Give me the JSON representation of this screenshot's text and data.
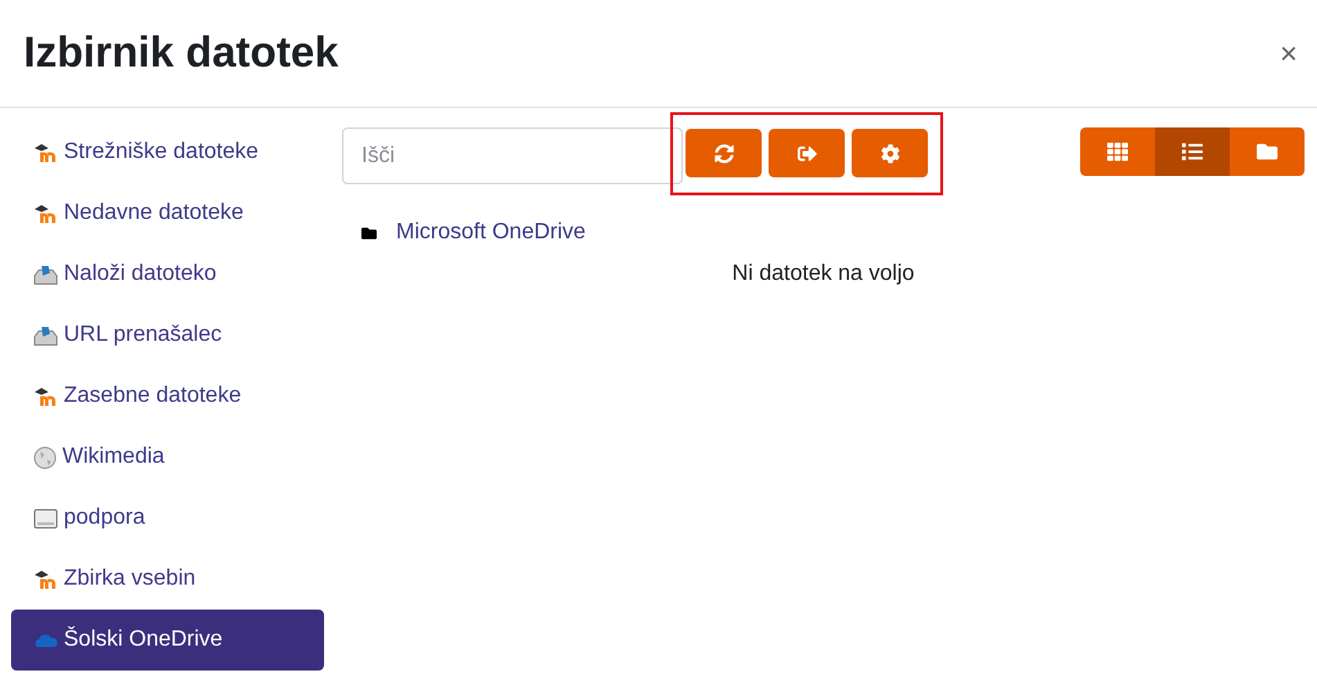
{
  "dialog": {
    "title": "Izbirnik datotek",
    "close": "×"
  },
  "sidebar": {
    "items": [
      {
        "label": "Strežniške datoteke",
        "kind": "moodle",
        "selected": false
      },
      {
        "label": "Nedavne datoteke",
        "kind": "moodle",
        "selected": false
      },
      {
        "label": "Naloži datoteko",
        "kind": "upload",
        "selected": false
      },
      {
        "label": "URL prenašalec",
        "kind": "upload",
        "selected": false
      },
      {
        "label": "Zasebne datoteke",
        "kind": "moodle",
        "selected": false
      },
      {
        "label": "Wikimedia",
        "kind": "wiki",
        "selected": false
      },
      {
        "label": "podpora",
        "kind": "server",
        "selected": false
      },
      {
        "label": "Zbirka vsebin",
        "kind": "moodle",
        "selected": false
      },
      {
        "label": "Šolski OneDrive",
        "kind": "onedrive",
        "selected": true
      }
    ]
  },
  "search": {
    "placeholder": "Išči"
  },
  "toolbar": {
    "highlighted": true,
    "buttons": [
      {
        "kind": "refresh"
      },
      {
        "kind": "logout"
      },
      {
        "kind": "settings"
      }
    ]
  },
  "views": [
    {
      "kind": "icons",
      "selected": false
    },
    {
      "kind": "list",
      "selected": true
    },
    {
      "kind": "tree",
      "selected": false
    }
  ],
  "files": [
    {
      "name": "Microsoft OneDrive",
      "kind": "folder"
    }
  ],
  "empty_message": "Ni datotek na voljo"
}
